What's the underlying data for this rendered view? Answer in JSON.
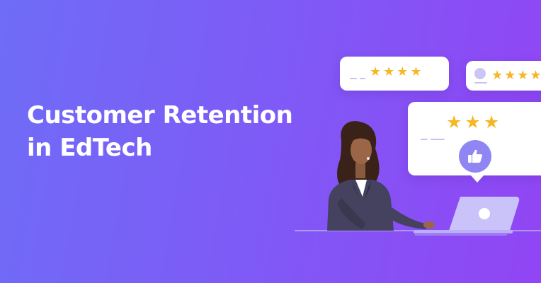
{
  "headline": {
    "line1": "Customer Retention",
    "line2": "in EdTech"
  },
  "review_cards": [
    {
      "stars": "★★★★",
      "rating": 4
    },
    {
      "stars": "★★★★",
      "rating": 4
    },
    {
      "stars": "★★★",
      "rating": 3
    }
  ],
  "colors": {
    "background_start": "#6f6cf7",
    "background_end": "#9145f4",
    "star": "#f6b726",
    "accent": "#8f86f3",
    "headline": "#ffffff"
  },
  "icons": [
    "thumbs-up-icon",
    "avatar-icon",
    "laptop-icon",
    "star-icon"
  ]
}
